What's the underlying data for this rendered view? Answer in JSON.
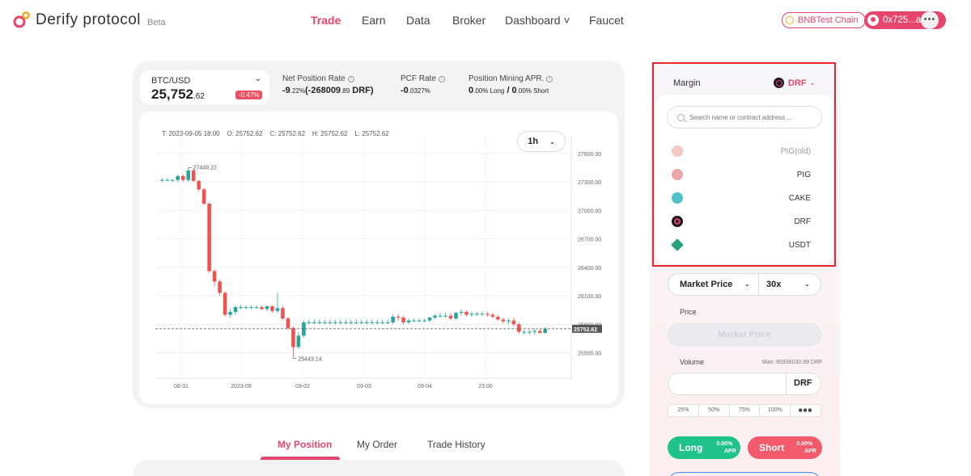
{
  "header": {
    "logo_text": "Derify protocol",
    "beta_label": "Beta",
    "nav": [
      {
        "label": "Trade",
        "active": true
      },
      {
        "label": "Earn"
      },
      {
        "label": "Data"
      },
      {
        "label": "Broker"
      },
      {
        "label": "Dashboard ˅"
      },
      {
        "label": "Faucet"
      }
    ],
    "chain_label": "BNBTest Chain",
    "wallet_label": "0x725...aA03",
    "more_label": "•••"
  },
  "market": {
    "pair": "BTC/USD",
    "price_main": "25,752",
    "price_decimal": ".62",
    "change": "-0.47%",
    "stats": [
      {
        "label": "Net Position Rate",
        "value": "-9",
        "value_small": ".22%",
        "value2": "(-268009",
        "value2_small": ".89",
        "value3": " DRF)"
      },
      {
        "label": "PCF Rate",
        "value": "-0",
        "value_small": ".0327%"
      },
      {
        "label": "Position Mining APR.",
        "value": "0",
        "value_small": ".00% Long",
        "value2": " / 0",
        "value2_small": ".00% Short"
      }
    ]
  },
  "chart_data": {
    "type": "candlestick",
    "ohlc_header": "T: 2023-09-05 18:00    O: 25752.62    C: 25752.62    H: 25752.62    L: 25752.62",
    "interval": "1h",
    "y_ticks": [
      "27600.00",
      "27300.00",
      "27000.00",
      "26700.00",
      "26400.00",
      "26100.00",
      "25800.00",
      "25500.00"
    ],
    "x_ticks": [
      "08-31",
      "2023-09",
      "09-02",
      "09-03",
      "09-04",
      "23:00"
    ],
    "ylim": [
      25300,
      27700
    ],
    "last_price": "25752.62",
    "max_label": "27449.22",
    "min_label": "25443.14",
    "candles": [
      {
        "o": 27320,
        "h": 27340,
        "l": 27300,
        "c": 27320
      },
      {
        "o": 27320,
        "h": 27340,
        "l": 27310,
        "c": 27320
      },
      {
        "o": 27320,
        "h": 27330,
        "l": 27300,
        "c": 27320
      },
      {
        "o": 27320,
        "h": 27380,
        "l": 27300,
        "c": 27360
      },
      {
        "o": 27360,
        "h": 27380,
        "l": 27300,
        "c": 27320
      },
      {
        "o": 27320,
        "h": 27449,
        "l": 27300,
        "c": 27420
      },
      {
        "o": 27420,
        "h": 27440,
        "l": 27300,
        "c": 27310
      },
      {
        "o": 27310,
        "h": 27320,
        "l": 27200,
        "c": 27220
      },
      {
        "o": 27220,
        "h": 27240,
        "l": 27050,
        "c": 27070
      },
      {
        "o": 27070,
        "h": 27080,
        "l": 26340,
        "c": 26360
      },
      {
        "o": 26360,
        "h": 26380,
        "l": 26200,
        "c": 26250
      },
      {
        "o": 26250,
        "h": 26270,
        "l": 26100,
        "c": 26130
      },
      {
        "o": 26130,
        "h": 26150,
        "l": 25880,
        "c": 25900
      },
      {
        "o": 25900,
        "h": 25960,
        "l": 25870,
        "c": 25930
      },
      {
        "o": 25930,
        "h": 26000,
        "l": 25900,
        "c": 25980
      },
      {
        "o": 25980,
        "h": 26000,
        "l": 25960,
        "c": 25980
      },
      {
        "o": 25980,
        "h": 26000,
        "l": 25960,
        "c": 25980
      },
      {
        "o": 25980,
        "h": 26000,
        "l": 25960,
        "c": 25980
      },
      {
        "o": 25980,
        "h": 26000,
        "l": 25960,
        "c": 25980
      },
      {
        "o": 25980,
        "h": 26000,
        "l": 25950,
        "c": 25960
      },
      {
        "o": 25960,
        "h": 26000,
        "l": 25940,
        "c": 25990
      },
      {
        "o": 25990,
        "h": 26000,
        "l": 25920,
        "c": 25940
      },
      {
        "o": 25940,
        "h": 26130,
        "l": 25920,
        "c": 25970
      },
      {
        "o": 25970,
        "h": 25990,
        "l": 25840,
        "c": 25860
      },
      {
        "o": 25860,
        "h": 25880,
        "l": 25740,
        "c": 25760
      },
      {
        "o": 25760,
        "h": 25780,
        "l": 25440,
        "c": 25560
      },
      {
        "o": 25560,
        "h": 25720,
        "l": 25540,
        "c": 25680
      },
      {
        "o": 25680,
        "h": 25840,
        "l": 25660,
        "c": 25820
      },
      {
        "o": 25820,
        "h": 25850,
        "l": 25800,
        "c": 25820
      },
      {
        "o": 25820,
        "h": 25850,
        "l": 25800,
        "c": 25820
      },
      {
        "o": 25820,
        "h": 25850,
        "l": 25800,
        "c": 25820
      },
      {
        "o": 25820,
        "h": 25850,
        "l": 25800,
        "c": 25820
      },
      {
        "o": 25820,
        "h": 25850,
        "l": 25800,
        "c": 25820
      },
      {
        "o": 25820,
        "h": 25850,
        "l": 25800,
        "c": 25820
      },
      {
        "o": 25820,
        "h": 25850,
        "l": 25800,
        "c": 25820
      },
      {
        "o": 25820,
        "h": 25850,
        "l": 25800,
        "c": 25820
      },
      {
        "o": 25820,
        "h": 25850,
        "l": 25800,
        "c": 25820
      },
      {
        "o": 25820,
        "h": 25850,
        "l": 25800,
        "c": 25820
      },
      {
        "o": 25820,
        "h": 25850,
        "l": 25800,
        "c": 25820
      },
      {
        "o": 25820,
        "h": 25850,
        "l": 25800,
        "c": 25820
      },
      {
        "o": 25820,
        "h": 25850,
        "l": 25800,
        "c": 25820
      },
      {
        "o": 25820,
        "h": 25850,
        "l": 25800,
        "c": 25820
      },
      {
        "o": 25820,
        "h": 25850,
        "l": 25800,
        "c": 25820
      },
      {
        "o": 25820,
        "h": 25850,
        "l": 25800,
        "c": 25820
      },
      {
        "o": 25820,
        "h": 25900,
        "l": 25800,
        "c": 25880
      },
      {
        "o": 25880,
        "h": 25910,
        "l": 25840,
        "c": 25870
      },
      {
        "o": 25870,
        "h": 25890,
        "l": 25800,
        "c": 25820
      },
      {
        "o": 25820,
        "h": 25860,
        "l": 25800,
        "c": 25840
      },
      {
        "o": 25840,
        "h": 25860,
        "l": 25820,
        "c": 25840
      },
      {
        "o": 25840,
        "h": 25860,
        "l": 25820,
        "c": 25840
      },
      {
        "o": 25840,
        "h": 25860,
        "l": 25820,
        "c": 25840
      },
      {
        "o": 25840,
        "h": 25880,
        "l": 25820,
        "c": 25870
      },
      {
        "o": 25870,
        "h": 25910,
        "l": 25850,
        "c": 25890
      },
      {
        "o": 25890,
        "h": 25920,
        "l": 25870,
        "c": 25890
      },
      {
        "o": 25890,
        "h": 25920,
        "l": 25870,
        "c": 25890
      },
      {
        "o": 25890,
        "h": 25920,
        "l": 25840,
        "c": 25860
      },
      {
        "o": 25860,
        "h": 25930,
        "l": 25850,
        "c": 25920
      },
      {
        "o": 25920,
        "h": 25960,
        "l": 25890,
        "c": 25930
      },
      {
        "o": 25930,
        "h": 25950,
        "l": 25880,
        "c": 25900
      },
      {
        "o": 25900,
        "h": 25930,
        "l": 25880,
        "c": 25910
      },
      {
        "o": 25910,
        "h": 25930,
        "l": 25890,
        "c": 25910
      },
      {
        "o": 25910,
        "h": 25930,
        "l": 25890,
        "c": 25910
      },
      {
        "o": 25910,
        "h": 25930,
        "l": 25880,
        "c": 25900
      },
      {
        "o": 25900,
        "h": 25920,
        "l": 25860,
        "c": 25880
      },
      {
        "o": 25880,
        "h": 25900,
        "l": 25840,
        "c": 25850
      },
      {
        "o": 25850,
        "h": 25870,
        "l": 25810,
        "c": 25830
      },
      {
        "o": 25830,
        "h": 25860,
        "l": 25800,
        "c": 25840
      },
      {
        "o": 25840,
        "h": 25870,
        "l": 25780,
        "c": 25800
      },
      {
        "o": 25800,
        "h": 25820,
        "l": 25700,
        "c": 25720
      },
      {
        "o": 25720,
        "h": 25740,
        "l": 25690,
        "c": 25720
      },
      {
        "o": 25720,
        "h": 25740,
        "l": 25690,
        "c": 25720
      },
      {
        "o": 25720,
        "h": 25750,
        "l": 25690,
        "c": 25730
      },
      {
        "o": 25730,
        "h": 25750,
        "l": 25700,
        "c": 25710
      },
      {
        "o": 25710,
        "h": 25770,
        "l": 25700,
        "c": 25752
      }
    ]
  },
  "tabs": [
    "My Position",
    "My Order",
    "Trade History"
  ],
  "trade_panel": {
    "margin_label": "Margin",
    "margin_token": "DRF",
    "search_placeholder": "Search name or contract address ...",
    "tokens": [
      {
        "name": "PIG(old)",
        "icon": "pig-icon",
        "color": "#f5c6c6",
        "dim": true
      },
      {
        "name": "PIG",
        "icon": "pig-icon",
        "color": "#e9a7a7"
      },
      {
        "name": "CAKE",
        "icon": "cake-icon",
        "color": "#4fc3c8"
      },
      {
        "name": "DRF",
        "icon": "drf-icon",
        "color": "#1b1b1f"
      },
      {
        "name": "USDT",
        "icon": "usdt-icon",
        "color": "#26a17b"
      }
    ],
    "order_type": "Market Price",
    "leverage": "30x",
    "price_label": "Price",
    "price_value": "Market Price",
    "volume_label": "Volume",
    "volume_max": "Max: 85936030.99 DRF",
    "volume_unit": "DRF",
    "percents": [
      "25%",
      "50%",
      "75%",
      "100%"
    ],
    "more_dots": "■■■",
    "long_label": "Long",
    "long_apr": "0.00%",
    "short_label": "Short",
    "short_apr": "0.00%",
    "apr_label": "APR",
    "colors": {
      "accent": "#e6456c",
      "long": "#1fc28a",
      "short": "#f2596a",
      "highlight_box": "#e8262c"
    }
  }
}
